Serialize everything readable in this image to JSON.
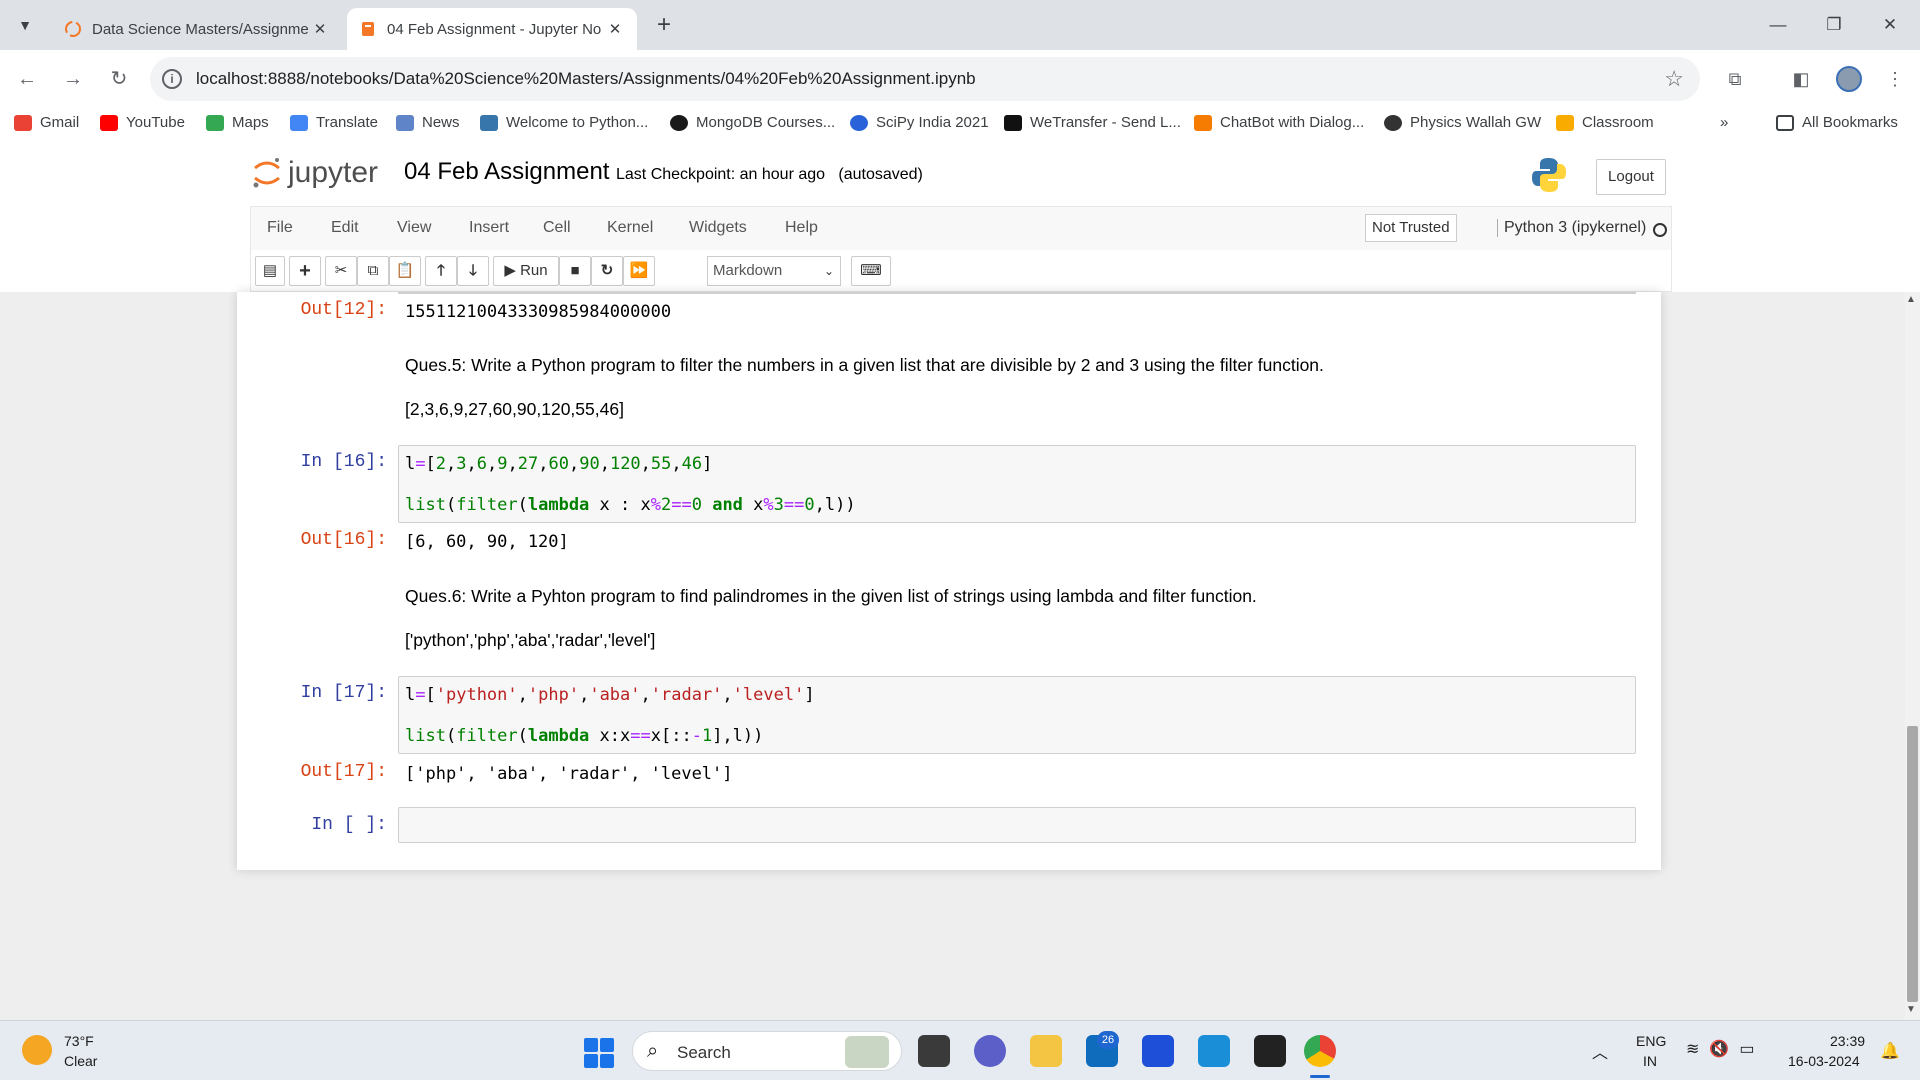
{
  "browser": {
    "tabs": [
      {
        "title": "Data Science Masters/Assignme",
        "active": false
      },
      {
        "title": "04 Feb Assignment - Jupyter No",
        "active": true
      }
    ],
    "new_tab": "+",
    "url": "localhost:8888/notebooks/Data%20Science%20Masters/Assignments/04%20Feb%20Assignment.ipynb",
    "bookmarks": [
      "Gmail",
      "YouTube",
      "Maps",
      "Translate",
      "News",
      "Welcome to Python...",
      "MongoDB Courses...",
      "SciPy India 2021",
      "WeTransfer - Send L...",
      "ChatBot with Dialog...",
      "Physics Wallah GW",
      "Classroom"
    ],
    "all_bookmarks": "All Bookmarks",
    "more": "»"
  },
  "jupyter": {
    "logo_text": "jupyter",
    "notebook_title": "04 Feb Assignment",
    "checkpoint": "Last Checkpoint: an hour ago",
    "autosave": "(autosaved)",
    "logout": "Logout",
    "menu": [
      "File",
      "Edit",
      "View",
      "Insert",
      "Cell",
      "Kernel",
      "Widgets",
      "Help"
    ],
    "not_trusted": "Not Trusted",
    "kernel": "Python 3 (ipykernel)",
    "toolbar": {
      "run_label": "Run",
      "cell_type": "Markdown"
    }
  },
  "cells": {
    "out12": {
      "prompt": "Out[12]:",
      "text": "15511210043330985984000000"
    },
    "q5": {
      "question": "Ques.5: Write a Python program to filter the numbers in a given list that are divisible by 2 and 3 using the filter function.",
      "list": "[2,3,6,9,27,60,90,120,55,46]"
    },
    "in16": {
      "prompt": "In [16]:"
    },
    "out16": {
      "prompt": "Out[16]:",
      "text": "[6, 60, 90, 120]"
    },
    "q6": {
      "question": "Ques.6: Write a Pyhton program to find palindromes in the given list of strings using lambda and filter function.",
      "list": "['python','php','aba','radar','level']"
    },
    "in17": {
      "prompt": "In [17]:"
    },
    "out17": {
      "prompt": "Out[17]:",
      "text": "['php', 'aba', 'radar', 'level']"
    },
    "empty": {
      "prompt": "In [ ]:"
    }
  },
  "taskbar": {
    "weather_temp": "73°F",
    "weather_cond": "Clear",
    "search": "Search",
    "mail_badge": "26",
    "lang_line1": "ENG",
    "lang_line2": "IN",
    "time": "23:39",
    "date": "16-03-2024"
  },
  "colors": {
    "tabstrip": "#dee1e6",
    "jupyter_orange": "#f37726",
    "prompt_in": "#303f9f",
    "prompt_out": "#d84315",
    "code_keyword": "#008000",
    "code_string": "#ba2121",
    "code_operator": "#aa22ff"
  }
}
